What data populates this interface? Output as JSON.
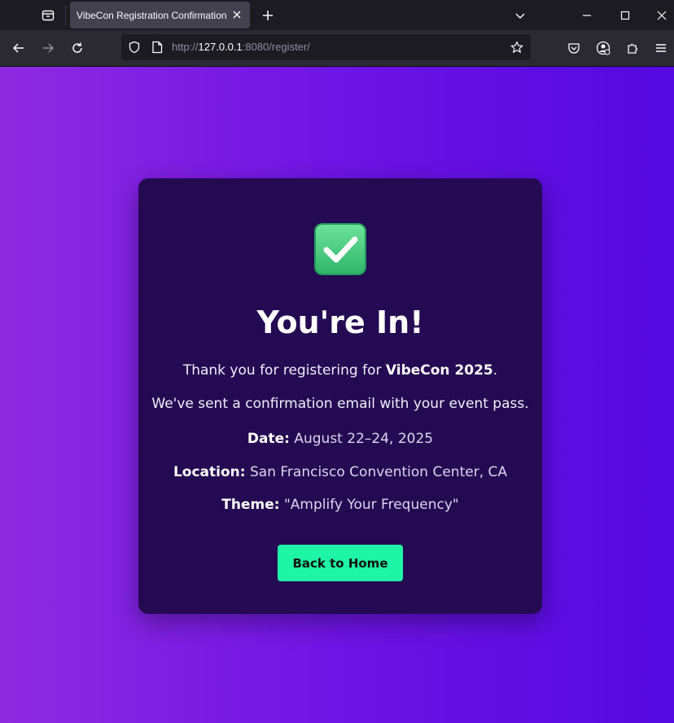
{
  "browser": {
    "tab_title": "VibeCon Registration Confirmation",
    "url_prefix": "http://",
    "url_host": "127.0.0.1",
    "url_rest": ":8080/register/"
  },
  "confirmation": {
    "icon": "check-mark-button-icon",
    "heading": "You're In!",
    "thanks_prefix": "Thank you for registering for ",
    "event_name": "VibeCon 2025",
    "thanks_suffix": ".",
    "email_note": "We've sent a confirmation email with your event pass.",
    "date_label": "Date:",
    "date_value": " August 22–24, 2025",
    "location_label": "Location:",
    "location_value": " San Francisco Convention Center, CA",
    "theme_label": "Theme:",
    "theme_value": " \"Amplify Your Frequency\"",
    "button_label": "Back to Home"
  },
  "colors": {
    "card_bg": "#230a52",
    "button_bg": "#1ef6a6",
    "gradient_start": "#8e2ae0",
    "gradient_end": "#5309e0"
  }
}
